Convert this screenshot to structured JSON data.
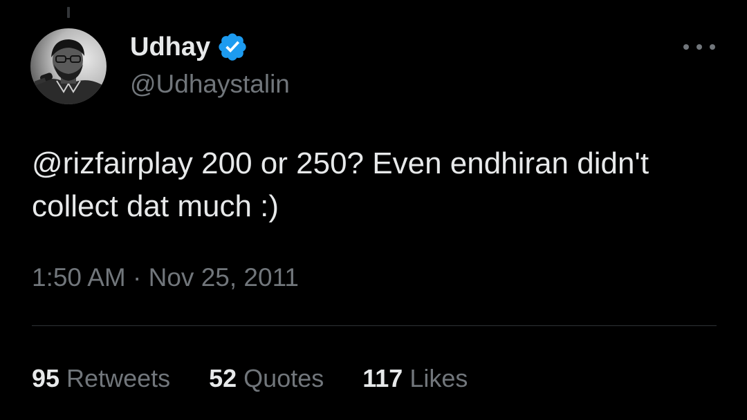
{
  "tweet": {
    "author": {
      "display_name": "Udhay",
      "handle": "@Udhaystalin",
      "verified": true,
      "verified_color": "#1d9bf0",
      "avatar_icon": "profile-photo-bw"
    },
    "text": "@rizfairplay 200 or 250? Even endhiran didn't collect dat much :)",
    "timestamp": "1:50 AM · Nov 25, 2011",
    "stats": {
      "retweets_count": "95",
      "retweets_label": "Retweets",
      "quotes_count": "52",
      "quotes_label": "Quotes",
      "likes_count": "117",
      "likes_label": "Likes"
    },
    "more_icon": "more-horizontal-icon"
  },
  "theme": {
    "background": "#000000",
    "primary_text": "#e7e9ea",
    "secondary_text": "#71767b",
    "divider": "#2f3336"
  }
}
